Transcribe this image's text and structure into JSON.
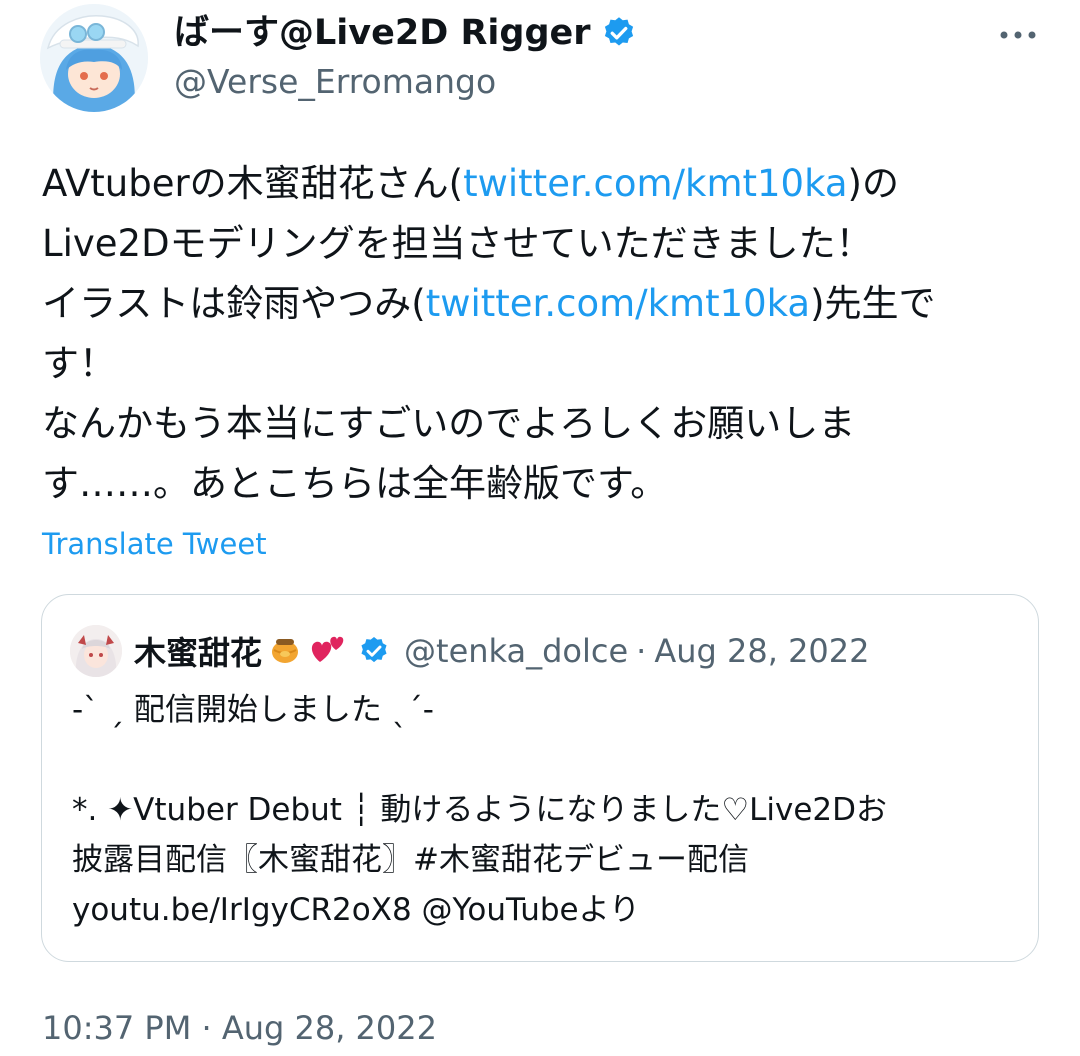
{
  "tweet": {
    "author_name": "ばーす@Live2D Rigger",
    "author_handle": "@Verse_Erromango",
    "avatar_icon": "avatar-character-icon",
    "verified_icon": "verified-badge-icon",
    "more_icon": "more-dots-icon",
    "text": {
      "p1": "AVtuberの木蜜甜花さん(",
      "link1": "twitter.com/kmt10ka",
      "p2": ")の\nLive2Dモデリングを担当させていただきました！\nイラストは鈴雨やつみ(",
      "link2": "twitter.com/kmt10ka",
      "p3": ")先生で\nす！\nなんかもう本当にすごいのでよろしくお願いしま\nす……。あとこちらは全年齢版です。"
    },
    "translate_label": "Translate Tweet",
    "timestamp": "10:37 PM · Aug 28, 2022"
  },
  "quote": {
    "author_name": "木蜜甜花",
    "emoji1": "🍯",
    "emoji2": "💕",
    "handle": "@tenka_dolce",
    "separator": "·",
    "date": "Aug 28, 2022",
    "text": "-ˋ ˏ 配信開始しました ˎˊ-\n\n*. ✦Vtuber Debut ┆ 動けるようになりました♡Live2Dお\n披露目配信〖木蜜甜花〗#木蜜甜花デビュー配信\nyoutu.be/IrIgyCR2oX8 @YouTubeより"
  },
  "colors": {
    "link": "#1d9bf0",
    "secondary_text": "#536471",
    "border": "#cfd9de"
  }
}
